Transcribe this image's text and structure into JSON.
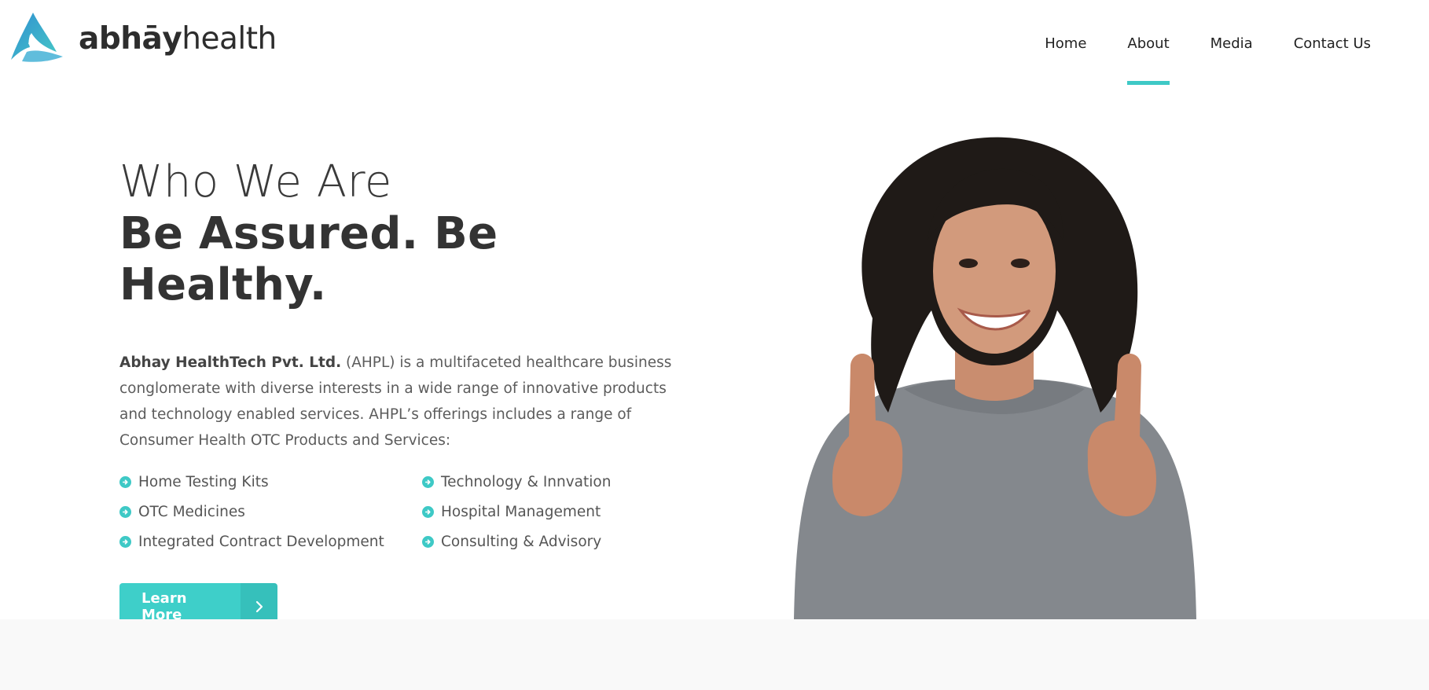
{
  "brand": {
    "name_bold": "abhāy",
    "name_light": "health",
    "logo_icon": "abhay-health-logo-icon",
    "accent_color": "#3ec9c6"
  },
  "nav": {
    "items": [
      {
        "label": "Home",
        "active": false
      },
      {
        "label": "About",
        "active": true
      },
      {
        "label": "Media",
        "active": false
      },
      {
        "label": "Contact Us",
        "active": false
      }
    ]
  },
  "hero": {
    "eyebrow": "Who We Are",
    "headline": "Be Assured. Be Healthy.",
    "intro_company": "Abhay HealthTech Pvt. Ltd.",
    "intro_text": " (AHPL) is a multifaceted healthcare business conglomerate with diverse interests in a wide range of innovative products and technology enabled services. AHPL’s offerings includes a range of Consumer Health OTC Products and Services:",
    "services": [
      "Home Testing Kits",
      "Technology & Innvation",
      "OTC Medicines",
      "Hospital Management",
      "Integrated Contract Development",
      "Consulting & Advisory"
    ],
    "service_icon": "arrow-circle-right-icon",
    "cta_label": "Learn More",
    "cta_icon": "chevron-right-icon",
    "photo_icon": "smiling-woman-thumbs-up-photo"
  }
}
